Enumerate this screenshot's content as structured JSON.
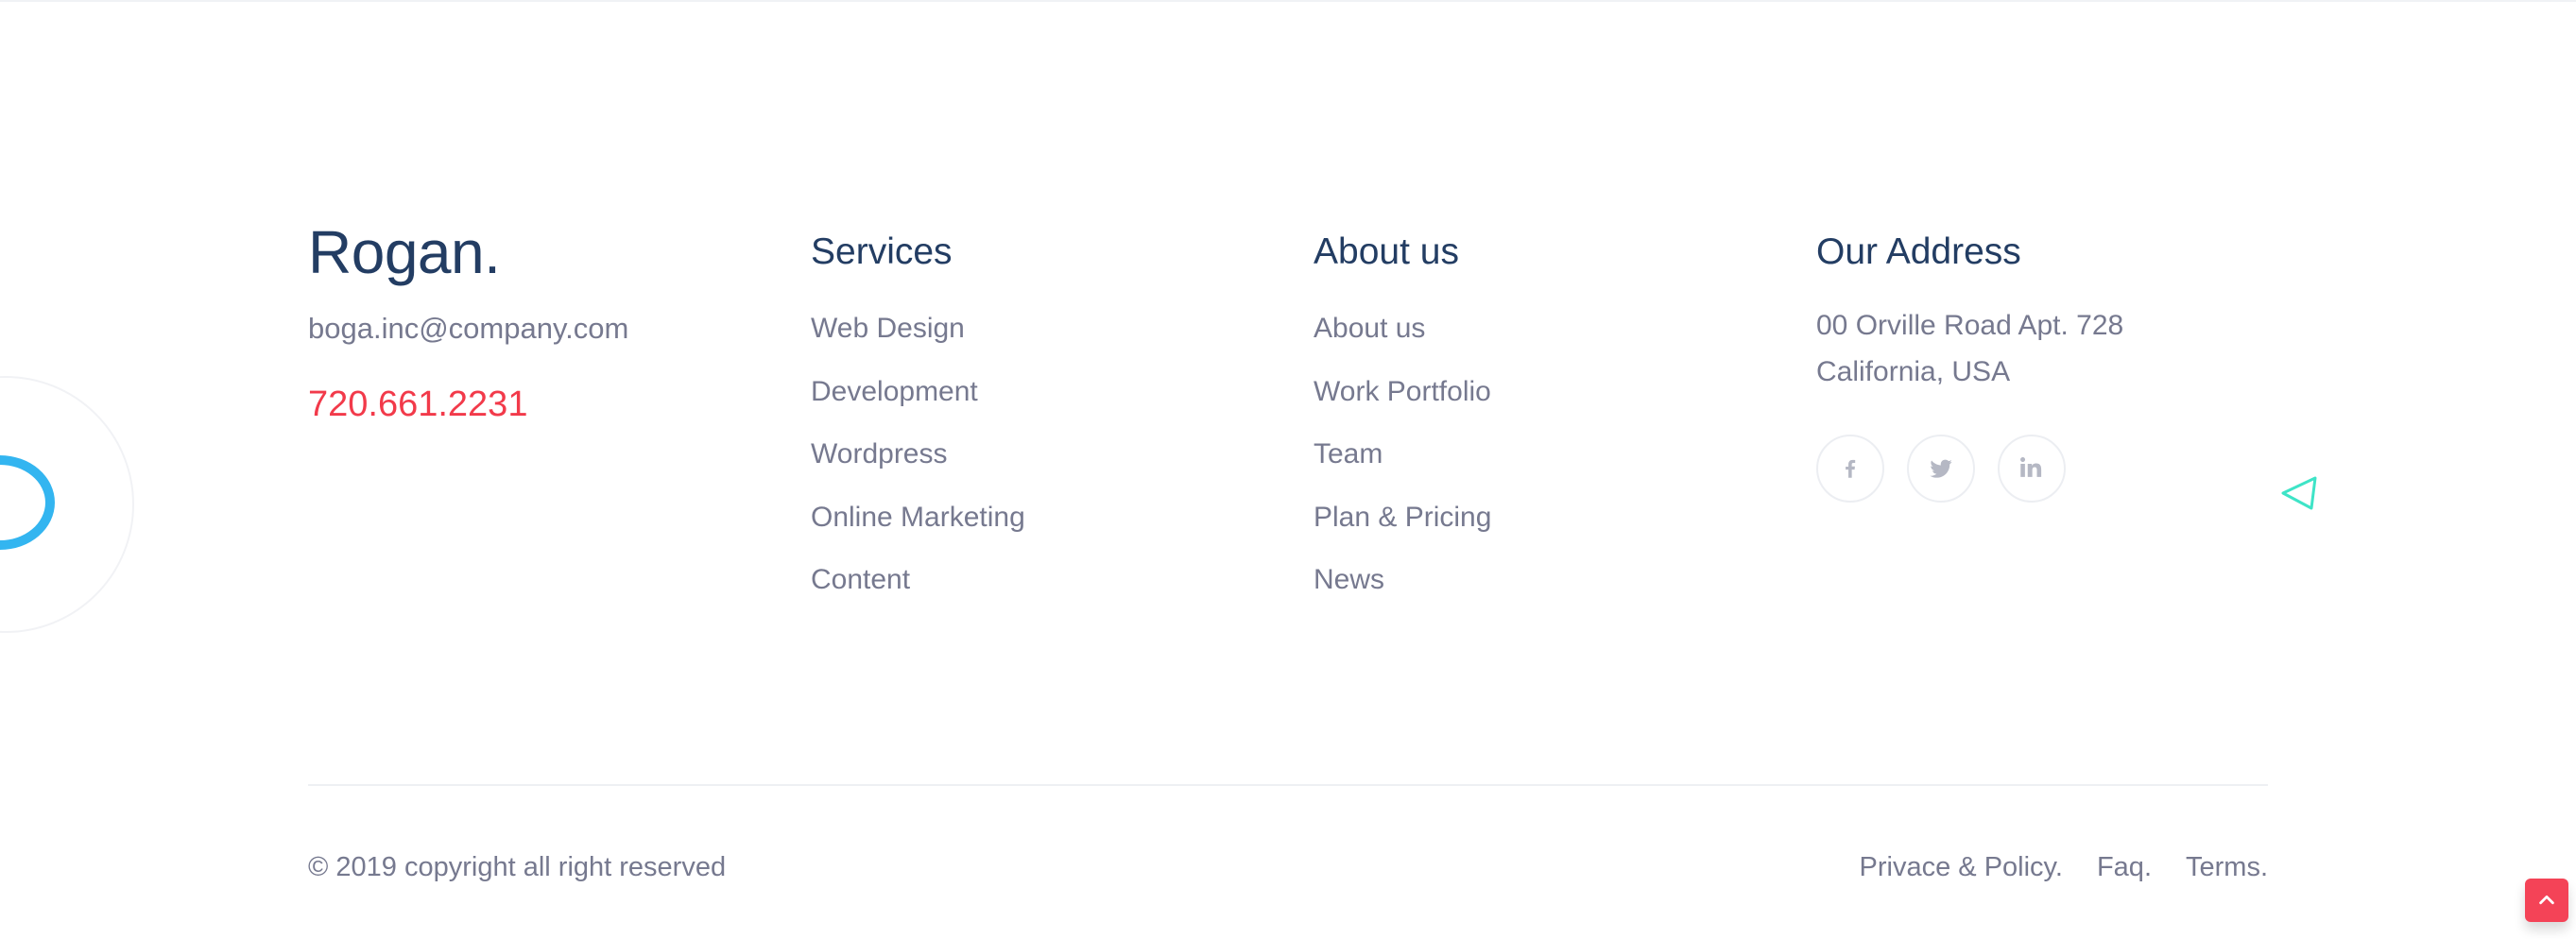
{
  "brand": {
    "name": "Rogan.",
    "email": "boga.inc@company.com",
    "phone": "720.661.2231"
  },
  "services": {
    "title": "Services",
    "items": [
      "Web Design",
      "Development",
      "Wordpress",
      "Online Marketing",
      "Content"
    ]
  },
  "about": {
    "title": "About us",
    "items": [
      "About us",
      "Work Portfolio",
      "Team",
      "Plan & Pricing",
      "News"
    ]
  },
  "address": {
    "title": "Our Address",
    "line1": "00 Orville Road Apt. 728",
    "line2": "California, USA"
  },
  "socials": [
    {
      "name": "facebook-icon",
      "glyph": "f"
    },
    {
      "name": "twitter-icon",
      "glyph": "t"
    },
    {
      "name": "linkedin-icon",
      "glyph": "in"
    }
  ],
  "footer": {
    "copyright": "© 2019 copyright all right reserved",
    "links": [
      "Privace & Policy.",
      "Faq.",
      "Terms."
    ]
  },
  "colors": {
    "heading": "#233d63",
    "text": "#76798f",
    "accent_red": "#f23a4a",
    "accent_blue": "#33b5f0",
    "accent_teal": "#3ee4c7"
  }
}
